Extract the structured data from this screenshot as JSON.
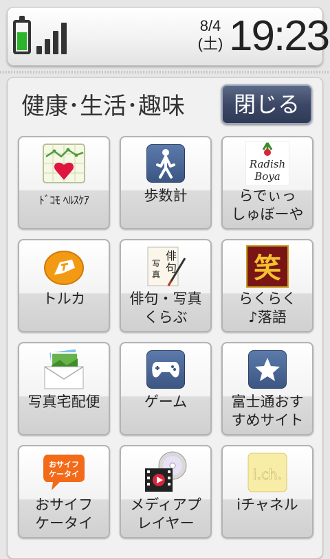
{
  "status_bar": {
    "date_line1": "8/4",
    "date_line2": "(土)",
    "time": "19:23",
    "battery_color": "#2bb52b"
  },
  "header": {
    "title": "健康･生活･趣味",
    "close_label": "閉じる"
  },
  "apps": [
    {
      "label": "ﾄﾞｺﾓ ﾍﾙｽｹｱ",
      "icon": "health-chart-heart-icon"
    },
    {
      "label": "歩数計",
      "icon": "walking-person-icon"
    },
    {
      "label": "らでぃっ\nしゅぼーや",
      "icon": "radish-boya-logo-icon",
      "logo_text": "Radish Boya"
    },
    {
      "label": "トルカ",
      "icon": "toruca-icon"
    },
    {
      "label": "俳句・写真\nくらぶ",
      "icon": "haiku-brush-icon",
      "icon_text": "俳句写真"
    },
    {
      "label": "らくらく\n♪落語",
      "icon": "rakugo-laugh-icon",
      "icon_text": "笑"
    },
    {
      "label": "写真宅配便",
      "icon": "photo-mail-envelope-icon"
    },
    {
      "label": "ゲーム",
      "icon": "game-controller-icon"
    },
    {
      "label": "富士通おす\nすめサイト",
      "icon": "star-icon"
    },
    {
      "label": "おサイフ\nケータイ",
      "icon": "osaifu-keitai-icon",
      "icon_text": "おサイフ\nケータイ"
    },
    {
      "label": "メディアプ\nレイヤー",
      "icon": "media-player-film-disc-icon"
    },
    {
      "label": "iチャネル",
      "icon": "ichannel-icon",
      "icon_text": "i.ch."
    }
  ]
}
